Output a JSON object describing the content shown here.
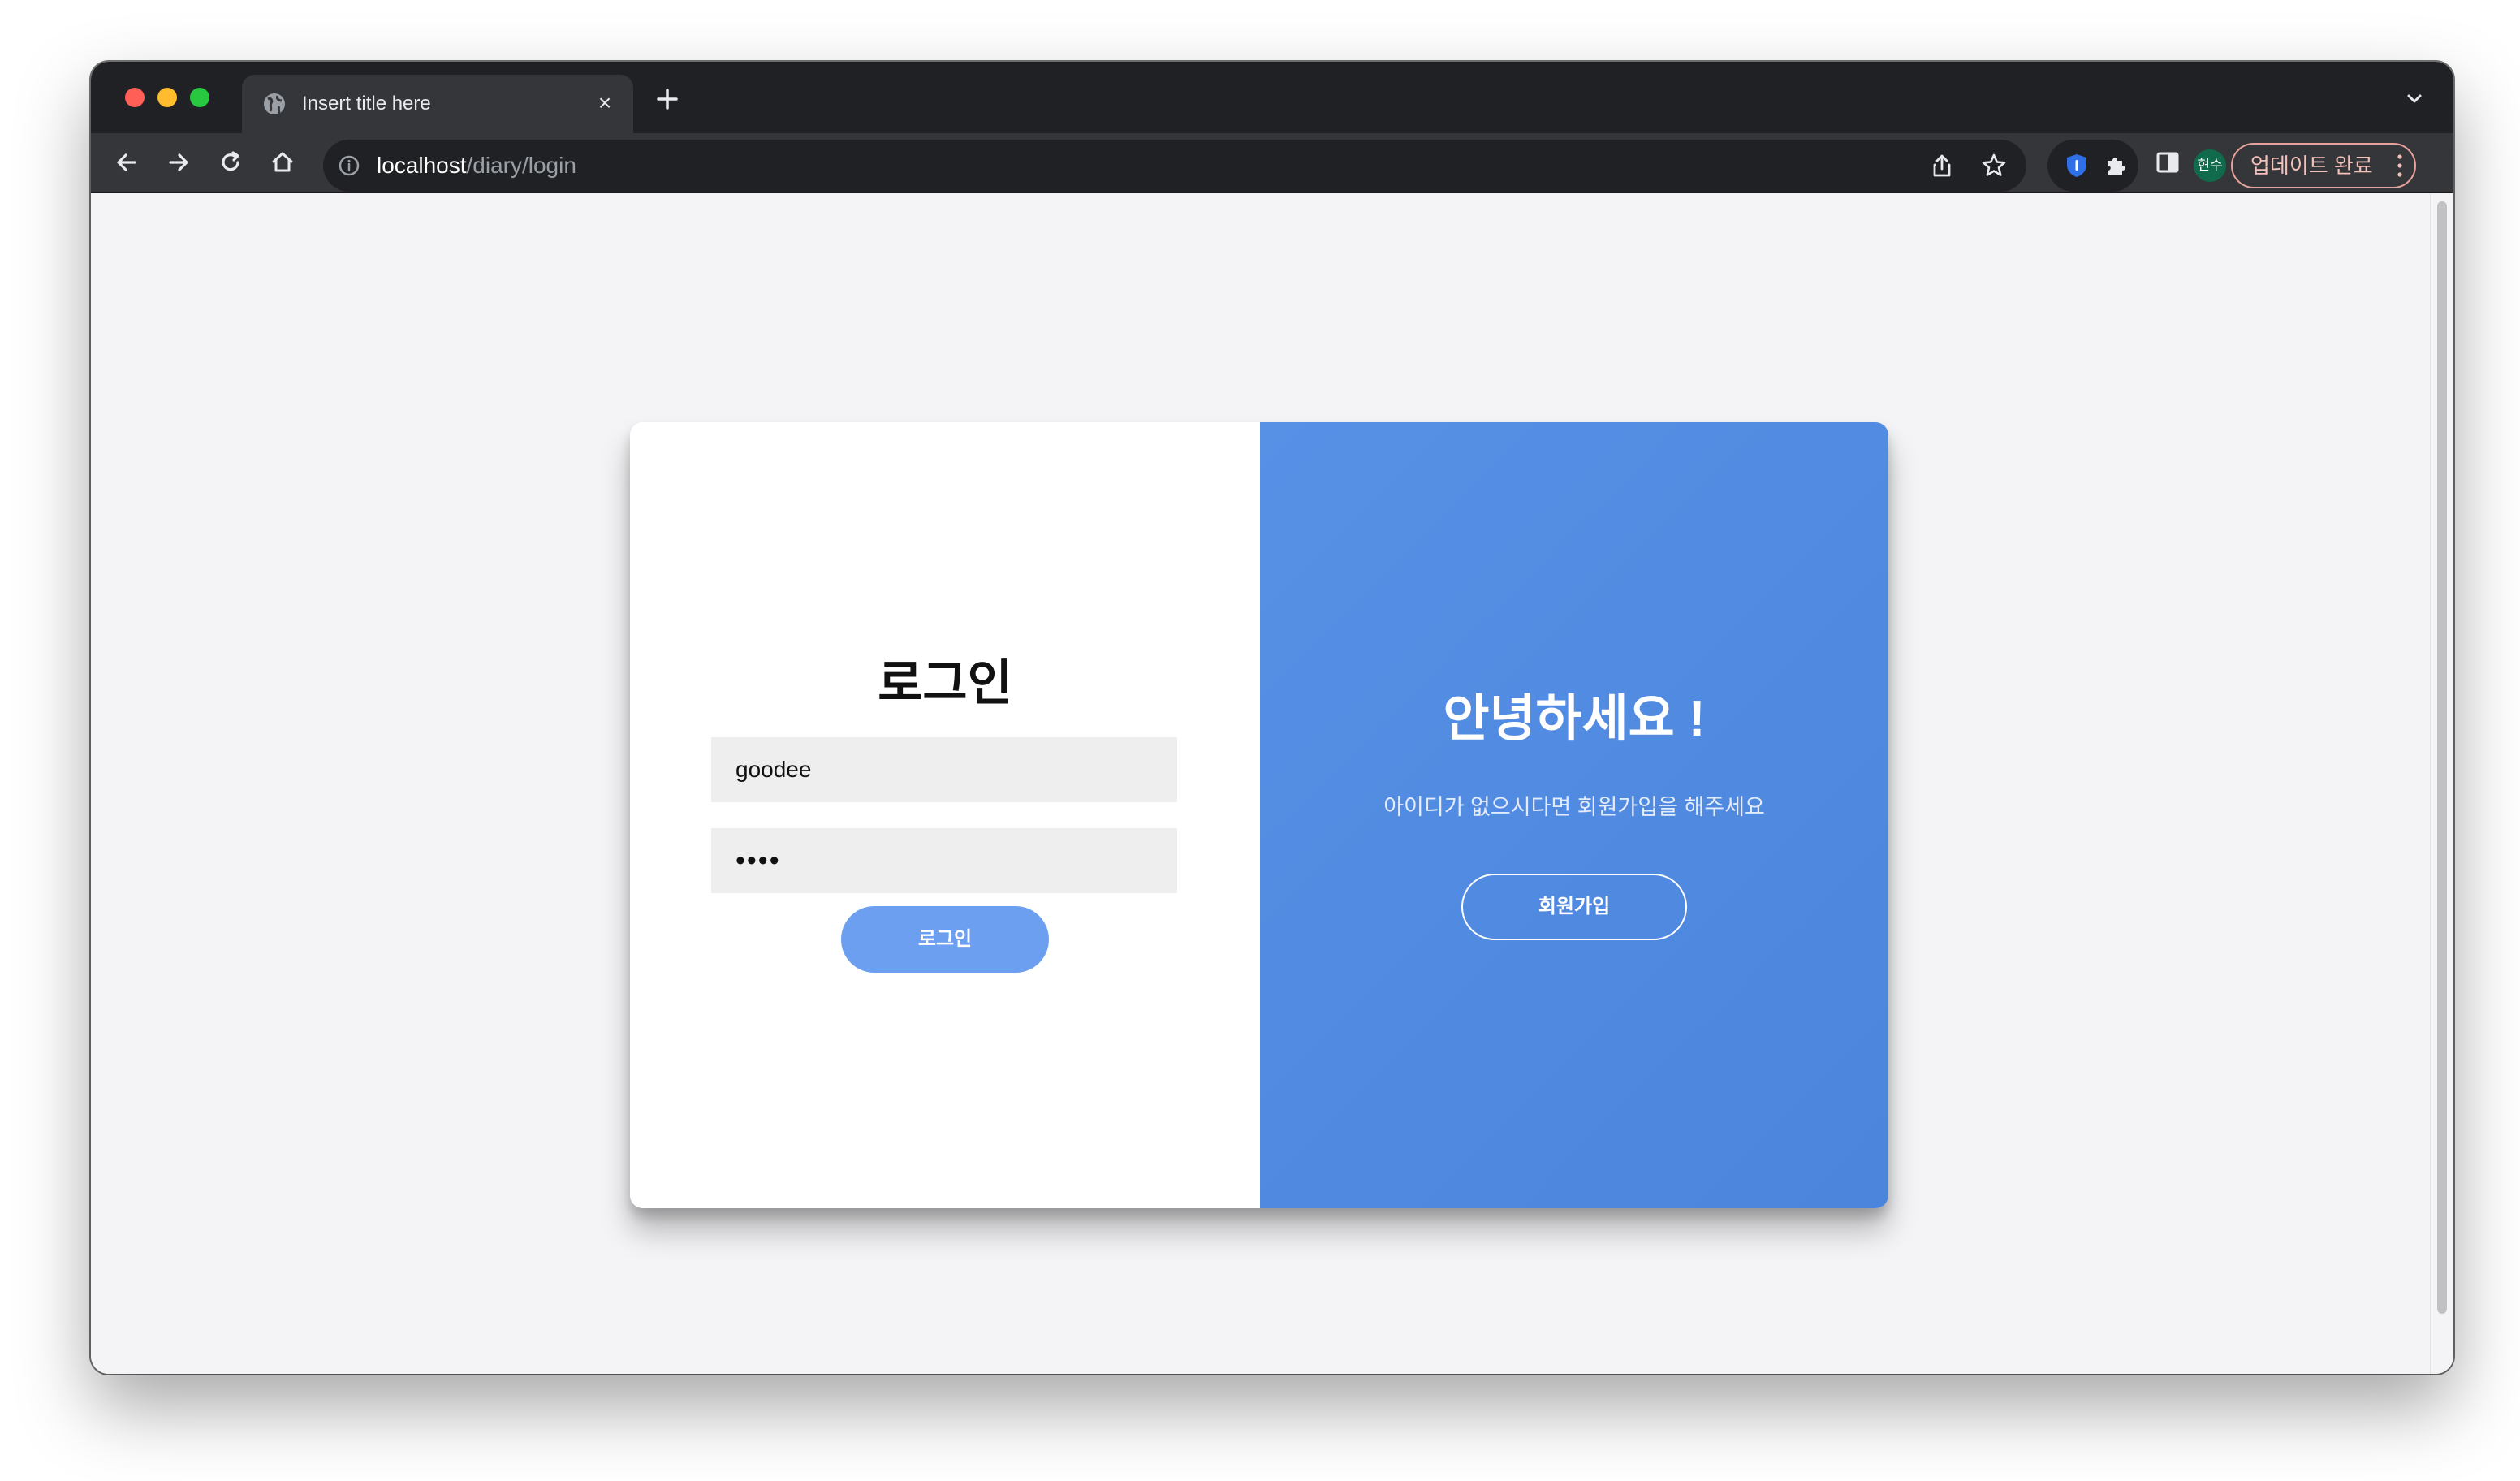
{
  "browser": {
    "tab_title": "Insert title here",
    "address_host": "localhost",
    "address_path": "/diary/login",
    "profile_label": "현수",
    "update_label": "업데이트 완료"
  },
  "login": {
    "title": "로그인",
    "id_value": "goodee",
    "password_mask": "••••",
    "button_label": "로그인"
  },
  "welcome": {
    "title": "안녕하세요 !",
    "subtitle": "아이디가 없으시다면 회원가입을 해주세요",
    "signup_label": "회원가입"
  },
  "colors": {
    "accent_panel": "#4f8ae2",
    "login_button": "#6c9ff0"
  }
}
